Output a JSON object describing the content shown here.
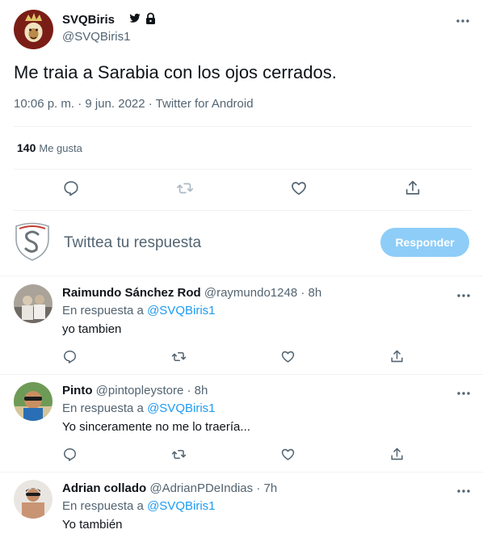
{
  "main_tweet": {
    "author_name": "SVQBiris",
    "author_handle": "@SVQBiris1",
    "text": "Me traia a Sarabia con los ojos cerrados.",
    "timestamp": "10:06 p. m. · 9 jun. 2022 · Twitter for Android",
    "likes_count": "140",
    "likes_label": "Me gusta",
    "name_icons": [
      "twitter-bird-icon",
      "lock-icon"
    ]
  },
  "reply_box": {
    "placeholder": "Twittea tu respuesta",
    "button_label": "Responder"
  },
  "replies": [
    {
      "name": "Raimundo Sánchez Rod",
      "handle": "@raymundo1248 · 8h",
      "in_reply_prefix": "En respuesta a ",
      "in_reply_to": "@SVQBiris1",
      "text": "yo tambien"
    },
    {
      "name": "Pinto",
      "handle": "@pintopleystore · 8h",
      "in_reply_prefix": "En respuesta a ",
      "in_reply_to": "@SVQBiris1",
      "text": "Yo sinceramente no me lo traería..."
    },
    {
      "name": "Adrian collado",
      "handle": "@AdrianPDeIndias · 7h",
      "in_reply_prefix": "En respuesta a ",
      "in_reply_to": "@SVQBiris1",
      "text": "Yo también"
    }
  ],
  "colors": {
    "accent": "#1d9bf0",
    "reply_button_disabled": "#8ecdf8",
    "secondary_text": "#536471",
    "divider": "#eff3f4"
  }
}
